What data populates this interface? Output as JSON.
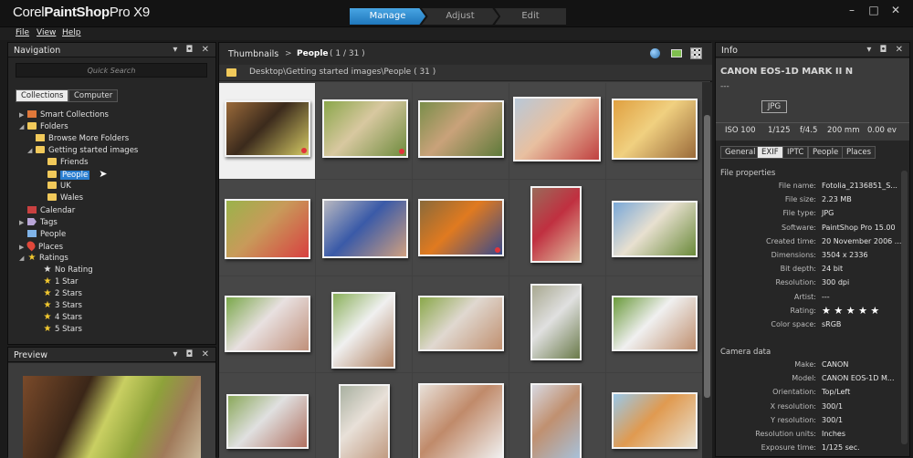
{
  "app": {
    "logo_part1": "Corel",
    "logo_part2": "PaintShop",
    "logo_part3": "Pro X9",
    "window_buttons": [
      "–",
      "□",
      "✕"
    ]
  },
  "modes": {
    "manage": "Manage",
    "adjust": "Adjust",
    "edit": "Edit"
  },
  "menu": {
    "file": "File",
    "view": "View",
    "help": "Help"
  },
  "nav": {
    "title": "Navigation",
    "panel_buttons": "▾ ◘ ✕",
    "search_placeholder": "Quick Search",
    "tabs": {
      "collections": "Collections",
      "computer": "Computer"
    },
    "tree": {
      "smart_collections": "Smart Collections",
      "folders": "Folders",
      "browse_more": "Browse More Folders",
      "getting_started": "Getting started images",
      "friends": "Friends",
      "people_folder": "People",
      "uk": "UK",
      "wales": "Wales",
      "calendar": "Calendar",
      "tags": "Tags",
      "people": "People",
      "places": "Places",
      "ratings": "Ratings",
      "no_rating": "No Rating",
      "star1": "1 Star",
      "star2": "2 Stars",
      "star3": "3 Stars",
      "star4": "4 Stars",
      "star5": "5 Stars"
    }
  },
  "preview": {
    "title": "Preview",
    "panel_buttons": "▾ ◘ ✕"
  },
  "thumbnails": {
    "title": "Thumbnails",
    "separator": ">",
    "crumb": "People",
    "count": "( 1 / 31 )",
    "path": "Desktop\\Getting started images\\People ( 31 )"
  },
  "info": {
    "title": "Info",
    "panel_buttons": "▾ ◘ ✕",
    "camera": "CANON EOS-1D MARK II N",
    "lens": "---",
    "format": "JPG",
    "stats": [
      "ISO 100",
      "1/125",
      "f/4.5",
      "200 mm",
      "0.00 ev"
    ],
    "tabs": [
      "General",
      "EXIF",
      "IPTC",
      "People",
      "Places"
    ],
    "file_section": "File properties",
    "file_props": [
      {
        "k": "File name:",
        "v": "Fotolia_2136851_S..."
      },
      {
        "k": "File size:",
        "v": "2.23 MB"
      },
      {
        "k": "File type:",
        "v": "JPG"
      },
      {
        "k": "Software:",
        "v": "PaintShop Pro 15.00"
      },
      {
        "k": "Created time:",
        "v": "20 November 2006 ..."
      },
      {
        "k": "Dimensions:",
        "v": "3504 x 2336"
      },
      {
        "k": "Bit depth:",
        "v": "24 bit"
      },
      {
        "k": "Resolution:",
        "v": "300 dpi"
      },
      {
        "k": "Artist:",
        "v": "---"
      },
      {
        "k": "Rating:",
        "v": "★ ★ ★ ★ ★"
      },
      {
        "k": "Color space:",
        "v": "sRGB"
      }
    ],
    "camera_section": "Camera data",
    "camera_props": [
      {
        "k": "Make:",
        "v": "CANON"
      },
      {
        "k": "Model:",
        "v": "CANON EOS-1D M..."
      },
      {
        "k": "Orientation:",
        "v": "Top/Left"
      },
      {
        "k": "X resolution:",
        "v": "300/1"
      },
      {
        "k": "Y resolution:",
        "v": "300/1"
      },
      {
        "k": "Resolution units:",
        "v": "Inches"
      },
      {
        "k": "Exposure time:",
        "v": "1/125 sec."
      }
    ]
  },
  "colors": {
    "accent": "#2a7ed0",
    "folder": "#f1c95a",
    "star": "#f3c92f",
    "flag": "#e2343a"
  },
  "icons": [
    "folder-icon",
    "star-icon",
    "globe-icon",
    "grid-view-icon",
    "map-icon",
    "pin-icon",
    "cursor-icon"
  ]
}
